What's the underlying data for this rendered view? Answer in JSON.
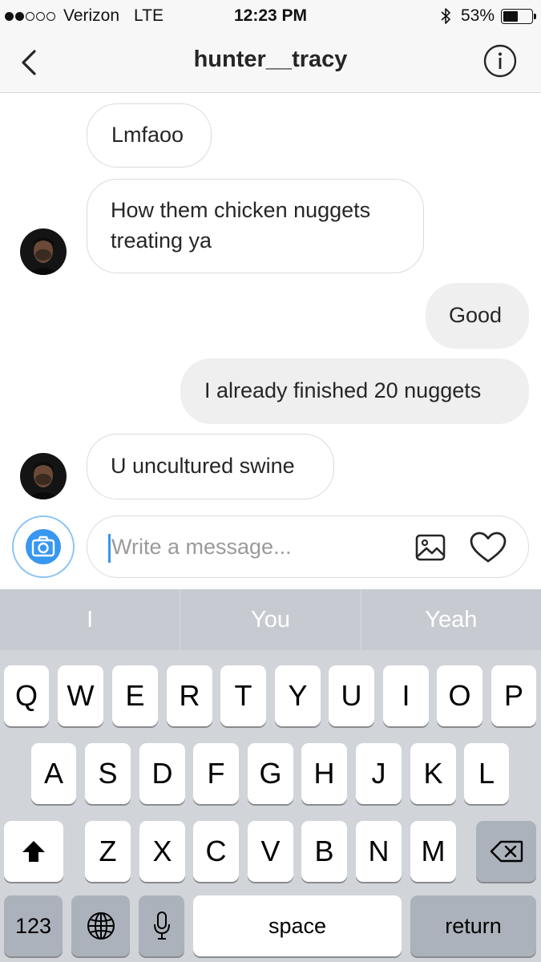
{
  "status_bar": {
    "carrier": "Verizon",
    "network": "LTE",
    "time": "12:23 PM",
    "battery_percent": "53%",
    "battery_level": 0.53,
    "signal_bars_filled": 2,
    "signal_bars_total": 5
  },
  "header": {
    "title": "hunter__tracy",
    "back_icon": "chevron-left-icon",
    "info_icon": "info-icon"
  },
  "messages": [
    {
      "direction": "incoming",
      "text": "Lmfaoo",
      "show_avatar": false
    },
    {
      "direction": "incoming",
      "text": "How them chicken nuggets treating ya",
      "show_avatar": true
    },
    {
      "direction": "outgoing",
      "text": "Good"
    },
    {
      "direction": "outgoing",
      "text": "I already finished 20 nuggets"
    },
    {
      "direction": "incoming",
      "text": "U uncultured swine",
      "show_avatar": true
    }
  ],
  "composer": {
    "placeholder": "Write a message...",
    "camera_icon": "camera-icon",
    "gallery_icon": "image-icon",
    "like_icon": "heart-icon"
  },
  "keyboard": {
    "suggestions": [
      "I",
      "You",
      "Yeah"
    ],
    "row1": [
      "Q",
      "W",
      "E",
      "R",
      "T",
      "Y",
      "U",
      "I",
      "O",
      "P"
    ],
    "row2": [
      "A",
      "S",
      "D",
      "F",
      "G",
      "H",
      "J",
      "K",
      "L"
    ],
    "row3": [
      "Z",
      "X",
      "C",
      "V",
      "B",
      "N",
      "M"
    ],
    "numbers_label": "123",
    "space_label": "space",
    "return_label": "return",
    "shift_icon": "shift-icon",
    "delete_icon": "backspace-icon",
    "globe_icon": "globe-icon",
    "mic_icon": "microphone-icon"
  },
  "colors": {
    "accent": "#3897f0",
    "outgoing_bubble": "#efefef",
    "incoming_border": "#dbdbdb",
    "keyboard_bg": "#d1d4d9",
    "suggestion_bar": "#c7cbd1"
  }
}
